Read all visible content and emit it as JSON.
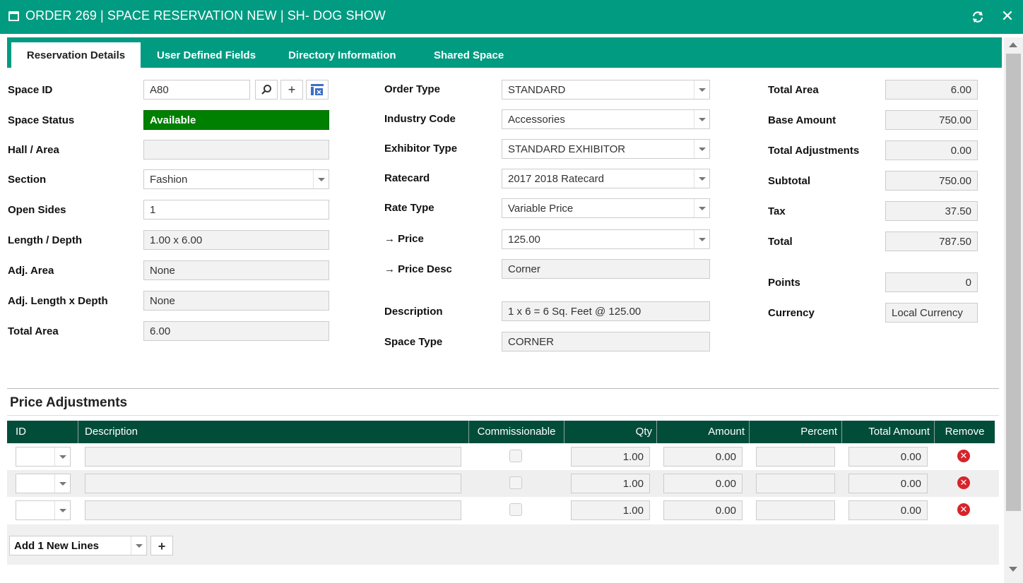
{
  "window": {
    "title": "ORDER 269 | SPACE RESERVATION NEW | SH- DOG SHOW"
  },
  "tabs": [
    "Reservation Details",
    "User Defined Fields",
    "Directory Information",
    "Shared Space"
  ],
  "left": {
    "space_id": {
      "label": "Space ID",
      "value": "A80"
    },
    "space_status": {
      "label": "Space Status",
      "value": "Available"
    },
    "hall_area": {
      "label": "Hall / Area",
      "value": ""
    },
    "section": {
      "label": "Section",
      "value": "Fashion"
    },
    "open_sides": {
      "label": "Open Sides",
      "value": "1"
    },
    "length_depth": {
      "label": "Length / Depth",
      "value": "1.00 x 6.00"
    },
    "adj_area": {
      "label": "Adj. Area",
      "value": "None"
    },
    "adj_length_depth": {
      "label": "Adj. Length x Depth",
      "value": "None"
    },
    "total_area": {
      "label": "Total Area",
      "value": "6.00"
    }
  },
  "middle": {
    "order_type": {
      "label": "Order Type",
      "value": "STANDARD"
    },
    "industry_code": {
      "label": "Industry Code",
      "value": "Accessories"
    },
    "exhibitor_type": {
      "label": "Exhibitor Type",
      "value": "STANDARD EXHIBITOR"
    },
    "ratecard": {
      "label": "Ratecard",
      "value": "2017 2018 Ratecard"
    },
    "rate_type": {
      "label": "Rate Type",
      "value": "Variable Price"
    },
    "price": {
      "label": "→ Price",
      "value": "125.00"
    },
    "price_desc": {
      "label": "→ Price Desc",
      "value": "Corner"
    },
    "description": {
      "label": "Description",
      "value": "1 x 6 = 6 Sq. Feet @ 125.00"
    },
    "space_type": {
      "label": "Space Type",
      "value": "CORNER"
    }
  },
  "right": {
    "total_area": {
      "label": "Total Area",
      "value": "6.00"
    },
    "base_amount": {
      "label": "Base Amount",
      "value": "750.00"
    },
    "total_adjustments": {
      "label": "Total Adjustments",
      "value": "0.00"
    },
    "subtotal": {
      "label": "Subtotal",
      "value": "750.00"
    },
    "tax": {
      "label": "Tax",
      "value": "37.50"
    },
    "total": {
      "label": "Total",
      "value": "787.50"
    },
    "points": {
      "label": "Points",
      "value": "0"
    },
    "currency": {
      "label": "Currency",
      "value": "Local Currency"
    }
  },
  "adjustments": {
    "title": "Price Adjustments",
    "columns": [
      "ID",
      "Description",
      "Commissionable",
      "Qty",
      "Amount",
      "Percent",
      "Total Amount",
      "Remove"
    ],
    "rows": [
      {
        "id": "",
        "description": "",
        "qty": "1.00",
        "amount": "0.00",
        "percent": "",
        "total_amount": "0.00"
      },
      {
        "id": "",
        "description": "",
        "qty": "1.00",
        "amount": "0.00",
        "percent": "",
        "total_amount": "0.00"
      },
      {
        "id": "",
        "description": "",
        "qty": "1.00",
        "amount": "0.00",
        "percent": "",
        "total_amount": "0.00"
      }
    ],
    "add_lines": {
      "value": "Add 1 New Lines",
      "button": "+"
    }
  },
  "colors": {
    "header": "#009b81",
    "grid_header": "#024d3a",
    "status_available": "#008000",
    "remove": "#d8232a"
  }
}
